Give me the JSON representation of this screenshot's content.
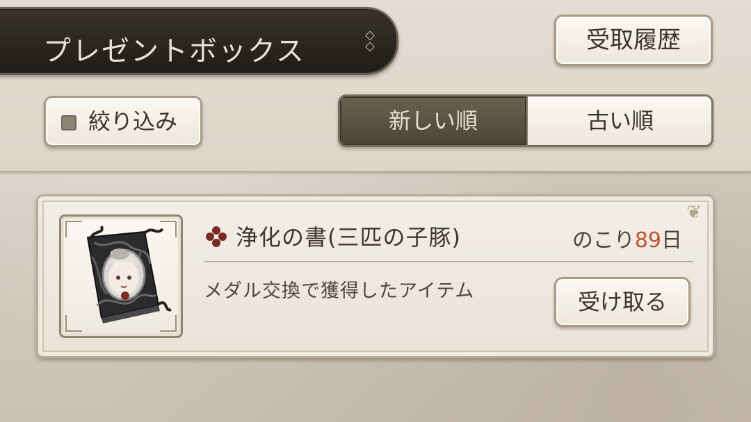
{
  "header": {
    "title": "プレゼントボックス",
    "history_button": "受取履歴"
  },
  "filters": {
    "filter_button": "絞り込み",
    "sort_new": "新しい順",
    "sort_old": "古い順",
    "selected_sort": "新しい順"
  },
  "items": [
    {
      "name": "浄化の書(三匹の子豚)",
      "remaining_label": "のこり",
      "remaining_days": "89",
      "remaining_unit": "日",
      "description": "メダル交換で獲得したアイテム",
      "receive_button": "受け取る"
    }
  ],
  "colors": {
    "accent_days": "#c0542e",
    "item_icon": "#7a2a22",
    "selected_segment": "#5a5344"
  }
}
